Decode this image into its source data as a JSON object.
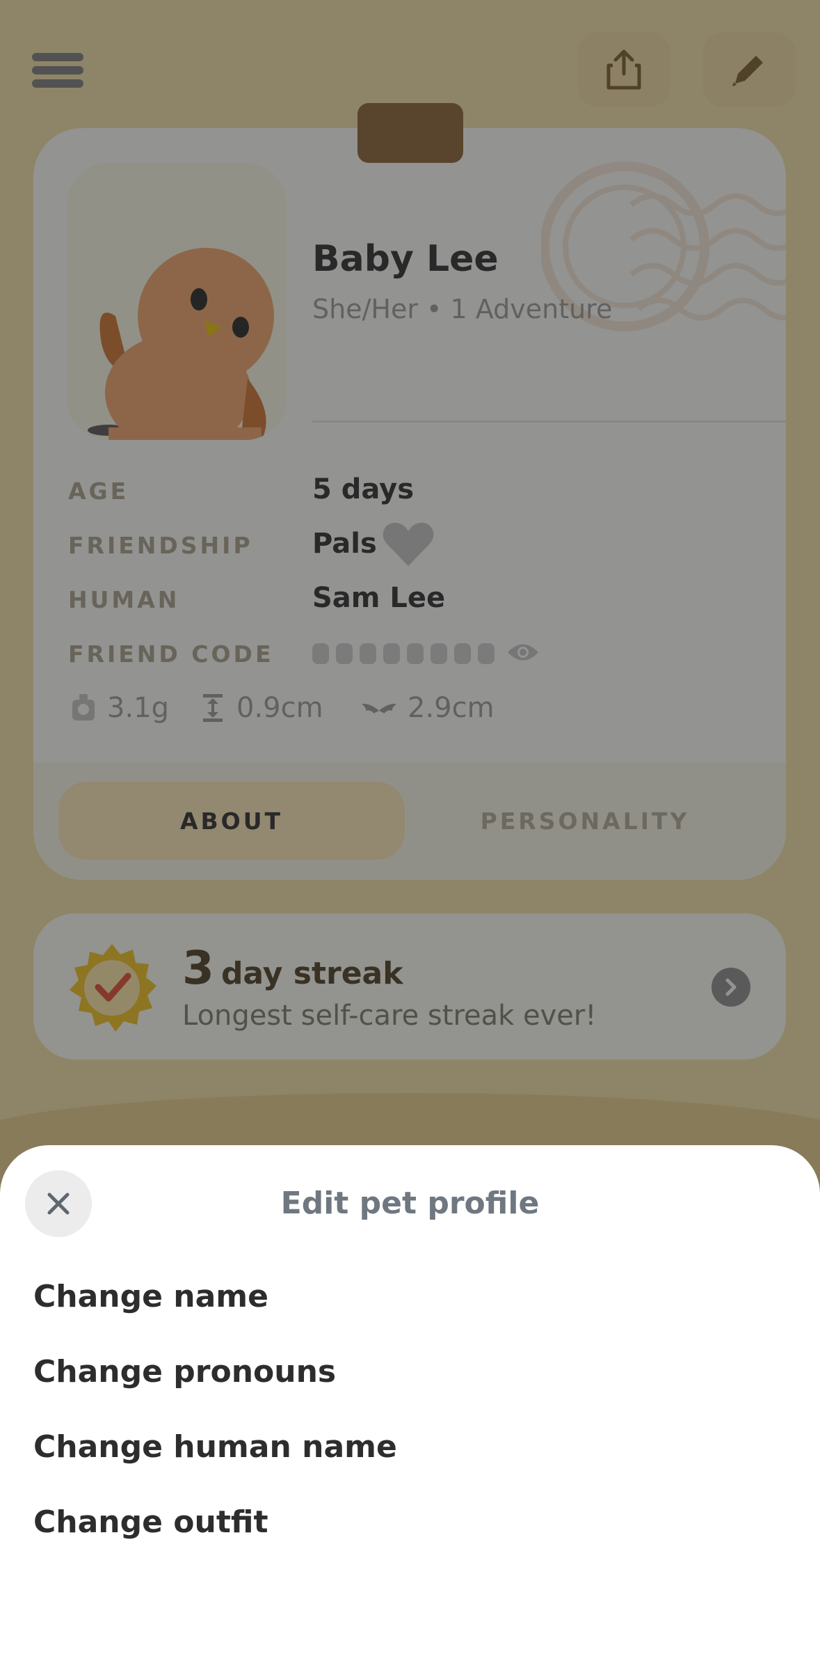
{
  "header": {
    "menu_icon": "hamburger-icon",
    "share_icon": "share-icon",
    "edit_icon": "pencil-icon"
  },
  "pet": {
    "name": "Baby Lee",
    "subtitle": "She/Her • 1 Adventure",
    "details": [
      {
        "label": "AGE",
        "value": "5 days"
      },
      {
        "label": "FRIENDSHIP",
        "value": "Pals"
      },
      {
        "label": "HUMAN",
        "value": "Sam Lee"
      },
      {
        "label": "FRIEND CODE",
        "value": ""
      }
    ],
    "stats": {
      "weight": "3.1g",
      "height": "0.9cm",
      "wingspan": "2.9cm"
    }
  },
  "tabs": {
    "about": "ABOUT",
    "personality": "PERSONALITY",
    "selected": "ABOUT"
  },
  "streak": {
    "number": "3",
    "label": "day streak",
    "subtitle": "Longest self-care streak ever!"
  },
  "sheet": {
    "title": "Edit pet profile",
    "items": [
      "Change name",
      "Change pronouns",
      "Change human name",
      "Change outfit"
    ]
  },
  "colors": {
    "background": "#f4e2a8",
    "accent": "#ffe8b8",
    "clip": "#8a6232",
    "pet": "#f2a56b"
  }
}
